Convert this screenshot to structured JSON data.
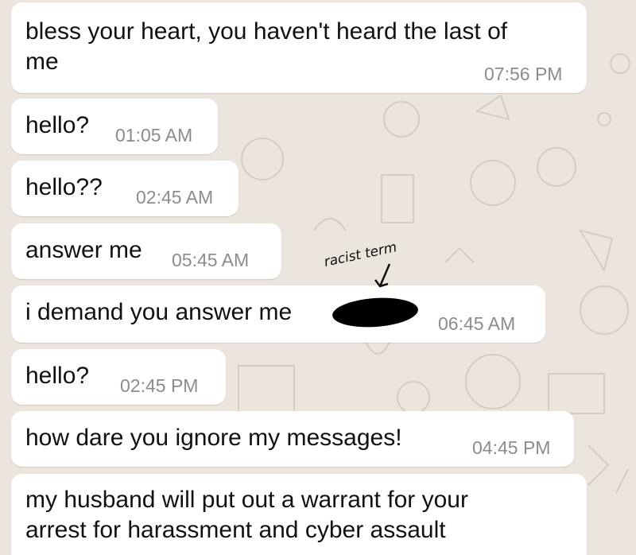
{
  "conversation": {
    "messages": [
      {
        "text_line1": "bless your heart, you haven't heard the last of",
        "text_line2": "me",
        "time": "07:56 PM"
      },
      {
        "text": "hello?",
        "time": "01:05 AM"
      },
      {
        "text": "hello??",
        "time": "02:45 AM"
      },
      {
        "text": "answer me",
        "time": "05:45 AM"
      },
      {
        "text": "i demand you answer me",
        "time": "06:45 AM",
        "redacted": true
      },
      {
        "text": "hello?",
        "time": "02:45 PM"
      },
      {
        "text": "how dare you ignore my messages!",
        "time": "04:45 PM"
      },
      {
        "text_line1": "my husband will put out a warrant for your",
        "text_line2": "arrest for harassment and cyber assault"
      }
    ]
  },
  "annotation": {
    "label": "racist term"
  },
  "colors": {
    "wallpaper": "#ece5dd",
    "bubble": "#ffffff",
    "text": "#111111",
    "timestamp": "#8c8c8c",
    "doodles": "#d8cfc4"
  }
}
